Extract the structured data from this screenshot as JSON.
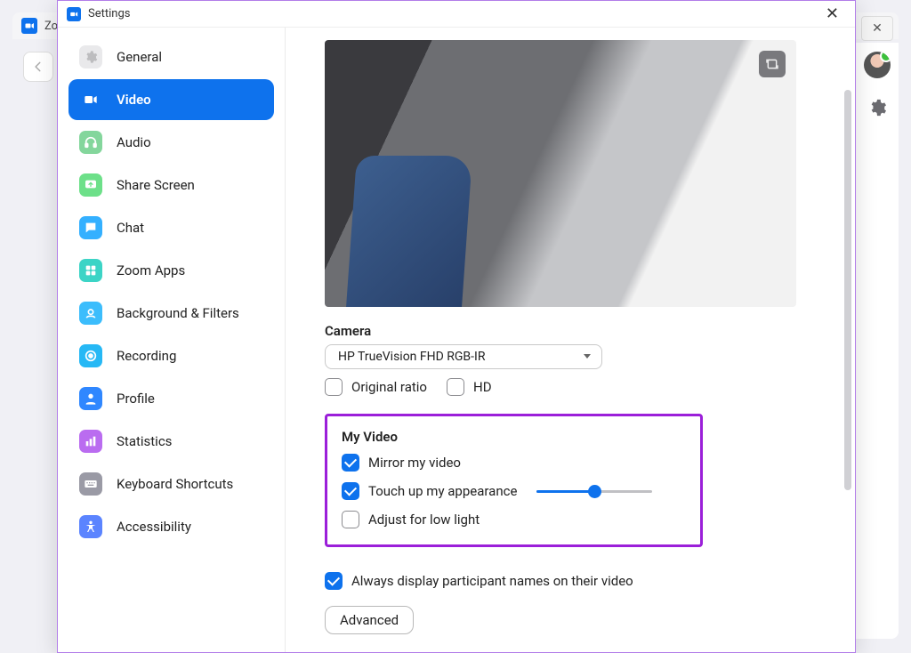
{
  "bg": {
    "app_name": "Zoo"
  },
  "modal": {
    "title": "Settings",
    "sidebar": {
      "items": [
        {
          "label": "General"
        },
        {
          "label": "Video"
        },
        {
          "label": "Audio"
        },
        {
          "label": "Share Screen"
        },
        {
          "label": "Chat"
        },
        {
          "label": "Zoom Apps"
        },
        {
          "label": "Background & Filters"
        },
        {
          "label": "Recording"
        },
        {
          "label": "Profile"
        },
        {
          "label": "Statistics"
        },
        {
          "label": "Keyboard Shortcuts"
        },
        {
          "label": "Accessibility"
        }
      ]
    }
  },
  "content": {
    "camera_label": "Camera",
    "camera_selected": "HP TrueVision FHD RGB-IR",
    "original_ratio_label": "Original ratio",
    "original_ratio_checked": false,
    "hd_label": "HD",
    "hd_checked": false,
    "my_video_label": "My Video",
    "mirror_label": "Mirror my video",
    "mirror_checked": true,
    "touchup_label": "Touch up my appearance",
    "touchup_checked": true,
    "touchup_slider_value": 50,
    "lowlight_label": "Adjust for low light",
    "lowlight_checked": false,
    "always_names_label": "Always display participant names on their video",
    "always_names_checked": true,
    "advanced_label": "Advanced"
  }
}
